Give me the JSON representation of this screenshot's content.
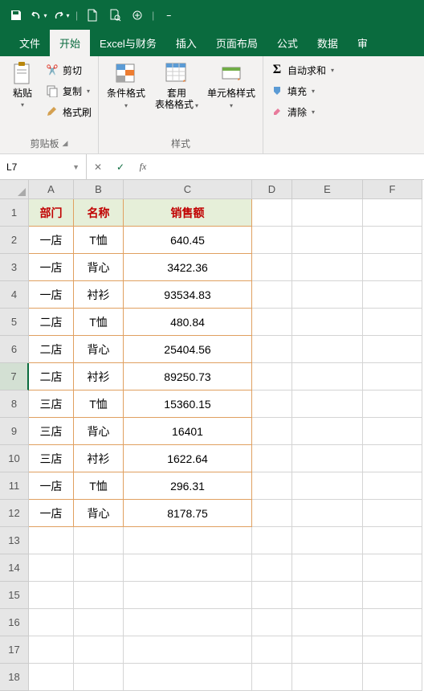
{
  "qat": {
    "save": "💾",
    "undo": "↶",
    "redo": "↷",
    "new": "🗋",
    "print": "🗎"
  },
  "tabs": [
    "文件",
    "开始",
    "Excel与财务",
    "插入",
    "页面布局",
    "公式",
    "数据",
    "审"
  ],
  "activeTab": 1,
  "ribbon": {
    "clipboard": {
      "paste": "粘贴",
      "cut": "剪切",
      "copy": "复制",
      "painter": "格式刷",
      "label": "剪贴板"
    },
    "styles": {
      "cond": "条件格式",
      "tbl_l1": "套用",
      "tbl_l2": "表格格式",
      "cellstyle": "单元格样式",
      "label": "样式"
    },
    "editing": {
      "sum": "自动求和",
      "fill": "填充",
      "clear": "清除"
    }
  },
  "nameBox": "L7",
  "formula": "",
  "cols": [
    "A",
    "B",
    "C",
    "D",
    "E",
    "F"
  ],
  "headers": [
    "部门",
    "名称",
    "销售额"
  ],
  "rows": [
    [
      "一店",
      "T恤",
      "640.45"
    ],
    [
      "一店",
      "背心",
      "3422.36"
    ],
    [
      "一店",
      "衬衫",
      "93534.83"
    ],
    [
      "二店",
      "T恤",
      "480.84"
    ],
    [
      "二店",
      "背心",
      "25404.56"
    ],
    [
      "二店",
      "衬衫",
      "89250.73"
    ],
    [
      "三店",
      "T恤",
      "15360.15"
    ],
    [
      "三店",
      "背心",
      "16401"
    ],
    [
      "三店",
      "衬衫",
      "1622.64"
    ],
    [
      "一店",
      "T恤",
      "296.31"
    ],
    [
      "一店",
      "背心",
      "8178.75"
    ]
  ],
  "selectedRow": 7,
  "emptyRows": [
    13,
    14,
    15,
    16,
    17,
    18
  ]
}
